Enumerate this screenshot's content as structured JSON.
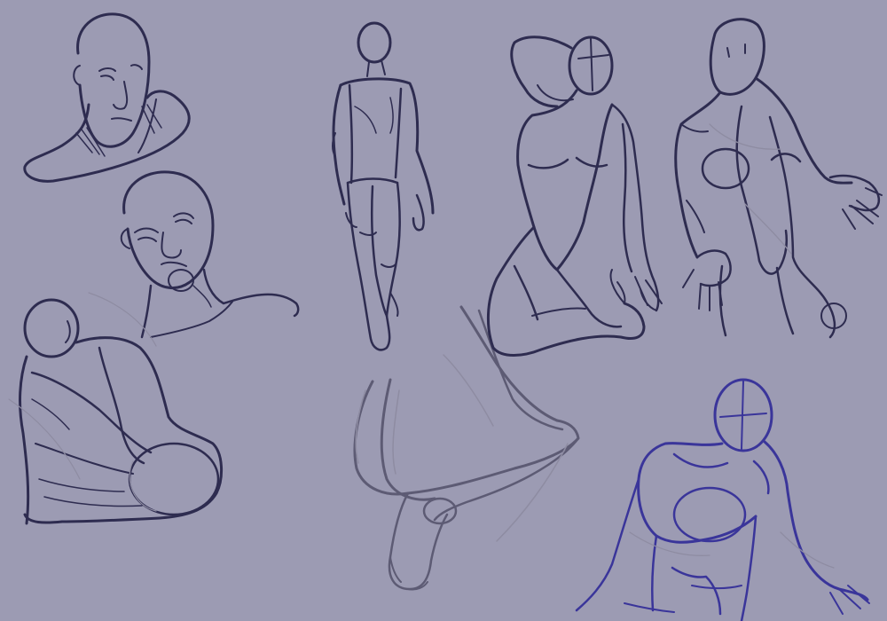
{
  "image": {
    "kind": "figure-drawing-sketch-sheet",
    "colors": {
      "background": "#9c9bb3",
      "ink_dark": "#2e2c50",
      "ink_light": "#5d5b74",
      "ink_blue": "#3a359a",
      "guide": "#8e8ca2"
    },
    "sketches": [
      "bald-head-portrait",
      "bald-head-upturned-portrait",
      "crouching-figure",
      "standing-walking-figure",
      "leg-and-foot-study",
      "arms-raised-female-torso-kneeling",
      "female-torso-open-hands",
      "seated-leaning-figure"
    ]
  }
}
